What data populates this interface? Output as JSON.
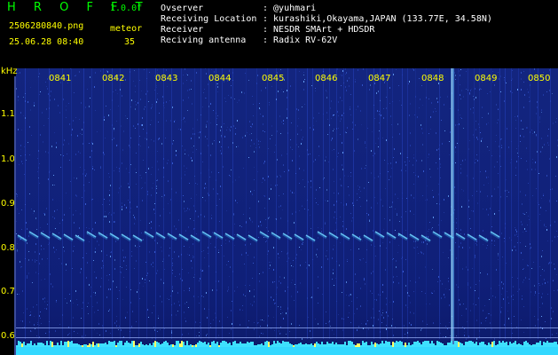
{
  "header": {
    "brand": "H R O F F T",
    "version": "1.0.0f",
    "filename": "2506280840.png",
    "mode": "meteor",
    "datetime": "25.06.28 08:40",
    "count": "35",
    "info": [
      {
        "key": "Ovserver",
        "value": ": @yuhmari"
      },
      {
        "key": "Receiving Location",
        "value": ": kurashiki,Okayama,JAPAN (133.77E, 34.58N)"
      },
      {
        "key": "Receiver",
        "value": ": NESDR SMArt + HDSDR"
      },
      {
        "key": "Reciving antenna",
        "value": ": Radix RV-62V"
      }
    ]
  },
  "axis": {
    "unit": "kHz",
    "time_labels": [
      "0841",
      "0842",
      "0843",
      "0844",
      "0845",
      "0846",
      "0847",
      "0848",
      "0849",
      "0850"
    ],
    "freq_labels": [
      "1.1",
      "1.0",
      "0.9",
      "0.8",
      "0.7",
      "0.6"
    ]
  },
  "colors": {
    "background": "#0f1f78",
    "label": "#ffff00",
    "brand": "#00ff00",
    "signal": "#7fd7ff"
  }
}
